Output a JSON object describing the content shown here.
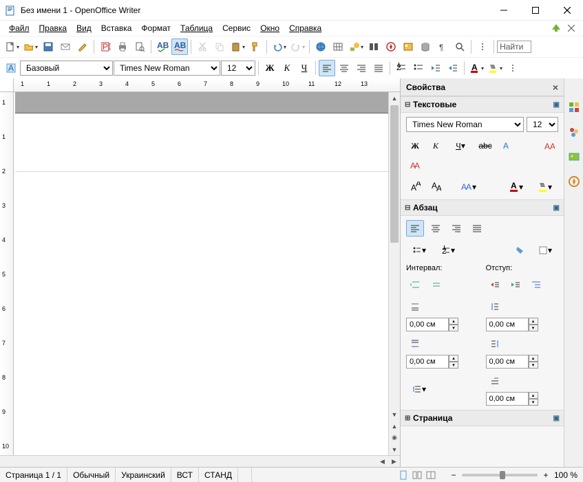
{
  "title": "Без имени 1 - OpenOffice Writer",
  "menus": [
    "Файл",
    "Правка",
    "Вид",
    "Вставка",
    "Формат",
    "Таблица",
    "Сервис",
    "Окно",
    "Справка"
  ],
  "find_label": "Найти",
  "toolbar2": {
    "style": "Базовый",
    "font": "Times New Roman",
    "size": "12"
  },
  "sidebar": {
    "title": "Свойства",
    "sec_text": "Текстовые",
    "font": "Times New Roman",
    "size": "12",
    "sec_para": "Абзац",
    "interval_label": "Интервал:",
    "indent_label": "Отступ:",
    "spacing_above": "0,00 см",
    "spacing_below": "0,00 см",
    "indent_left": "0,00 см",
    "indent_right": "0,00 см",
    "indent_first": "0,00 см",
    "sec_page": "Страница"
  },
  "status": {
    "page": "Страница  1 / 1",
    "style": "Обычный",
    "lang": "Украинский",
    "ins": "ВСТ",
    "std": "СТАНД",
    "zoom": "100 %"
  },
  "ruler_h": [
    "1",
    "1",
    "2",
    "3",
    "4",
    "5",
    "6",
    "7",
    "8",
    "9",
    "10",
    "11",
    "12",
    "13"
  ],
  "ruler_v": [
    "1",
    "1",
    "2",
    "3",
    "4",
    "5",
    "6",
    "7",
    "8",
    "9",
    "10"
  ]
}
